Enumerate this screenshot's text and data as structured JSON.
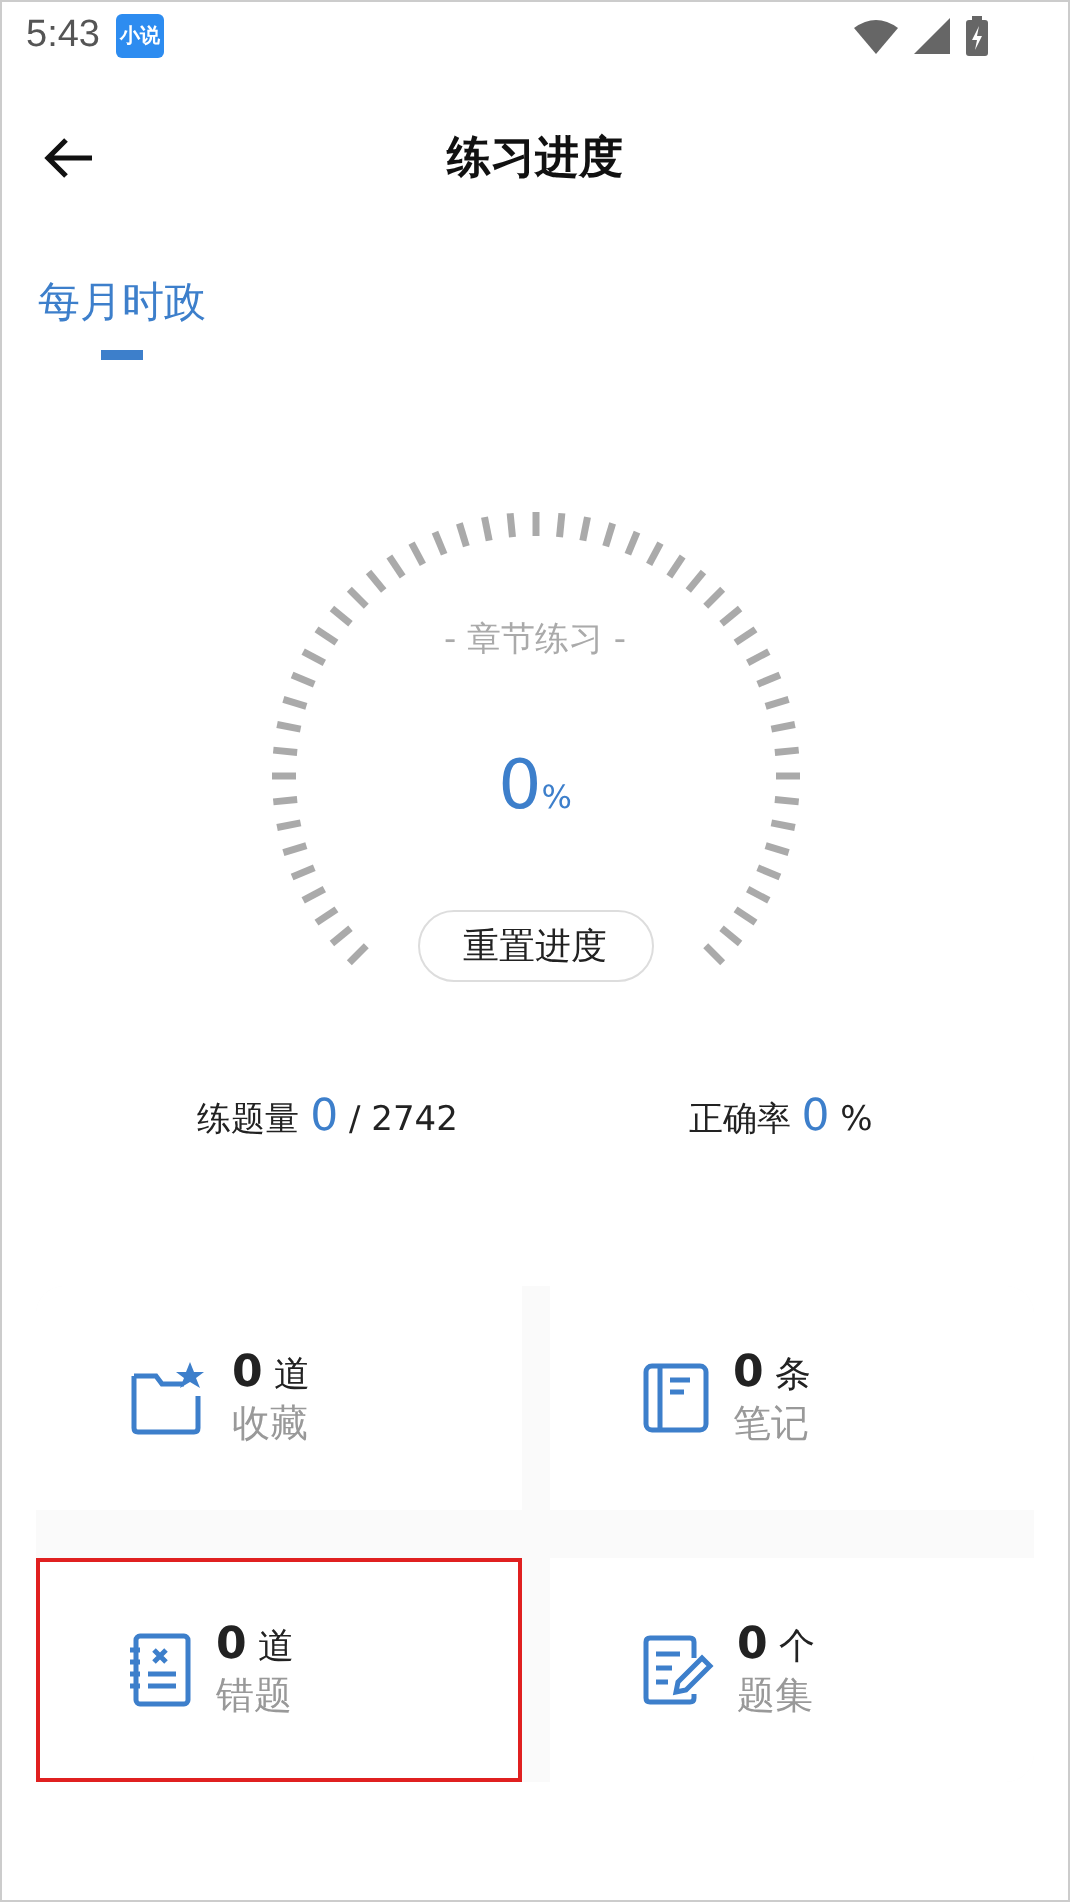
{
  "status_bar": {
    "time": "5:43",
    "app_badge": "小说"
  },
  "header": {
    "title": "练习进度"
  },
  "tabs": [
    {
      "label": "每月时政",
      "selected": true
    }
  ],
  "gauge": {
    "caption": "- 章节练习 -",
    "value": "0",
    "unit": "%",
    "reset_button": "重置进度"
  },
  "stats": [
    {
      "label": "练题量",
      "value": "0",
      "suffix": "/ 2742"
    },
    {
      "label": "正确率",
      "value": "0",
      "suffix": "%"
    }
  ],
  "cards": [
    {
      "kind": "favorites",
      "count": "0",
      "unit": "道",
      "label": "收藏",
      "highlighted": false
    },
    {
      "kind": "notes",
      "count": "0",
      "unit": "条",
      "label": "笔记",
      "highlighted": false
    },
    {
      "kind": "mistakes",
      "count": "0",
      "unit": "道",
      "label": "错题",
      "highlighted": true
    },
    {
      "kind": "sets",
      "count": "0",
      "unit": "个",
      "label": "题集",
      "highlighted": false
    }
  ]
}
